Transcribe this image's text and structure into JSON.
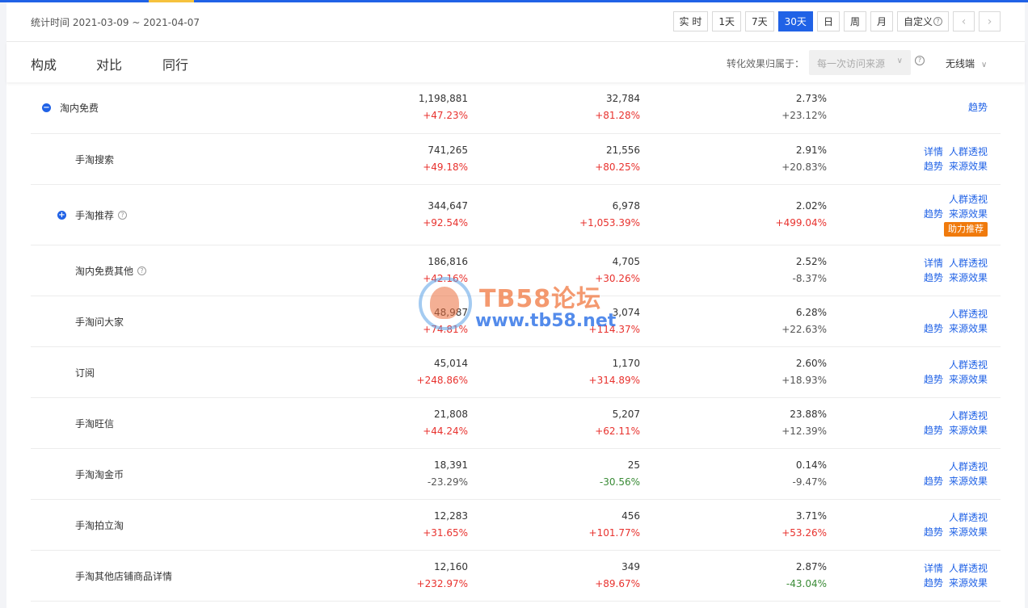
{
  "header": {
    "date_range": "统计时间 2021-03-09 ~ 2021-04-07",
    "periods": [
      {
        "label": "实 时",
        "active": false
      },
      {
        "label": "1天",
        "active": false
      },
      {
        "label": "7天",
        "active": false
      },
      {
        "label": "30天",
        "active": true
      },
      {
        "label": "日",
        "active": false
      },
      {
        "label": "周",
        "active": false
      },
      {
        "label": "月",
        "active": false
      }
    ],
    "custom_label": "自定义",
    "prev_icon": "chevron-left-icon",
    "next_icon": "chevron-right-icon"
  },
  "tabs": [
    {
      "label": "构成",
      "active": true
    },
    {
      "label": "对比",
      "active": false
    },
    {
      "label": "同行",
      "active": false
    }
  ],
  "attribution": {
    "label": "转化效果归属于：",
    "select_value": "每一次访问来源",
    "device": "无线端"
  },
  "colors": {
    "accent": "#2062e6",
    "up": "#e8322e",
    "down": "#3a8b36",
    "boost": "#f07a0c"
  },
  "rows": [
    {
      "name": "淘内免费",
      "level": 0,
      "toggle": "−",
      "help": false,
      "m1": {
        "v": "1,198,881",
        "c": "+47.23%",
        "dir": "up"
      },
      "m2": {
        "v": "32,784",
        "c": "+81.28%",
        "dir": "up"
      },
      "m3": {
        "v": "2.73%",
        "c": "+23.12%",
        "dir": "neutral"
      },
      "actions": [
        [
          "趋势"
        ]
      ],
      "boost": null
    },
    {
      "name": "手淘搜索",
      "level": 1,
      "toggle": null,
      "help": false,
      "m1": {
        "v": "741,265",
        "c": "+49.18%",
        "dir": "up"
      },
      "m2": {
        "v": "21,556",
        "c": "+80.25%",
        "dir": "up"
      },
      "m3": {
        "v": "2.91%",
        "c": "+20.83%",
        "dir": "neutral"
      },
      "actions": [
        [
          "详情",
          "人群透视"
        ],
        [
          "趋势",
          "来源效果"
        ]
      ],
      "boost": null
    },
    {
      "name": "手淘推荐",
      "level": 1,
      "toggle": "+",
      "help": true,
      "m1": {
        "v": "344,647",
        "c": "+92.54%",
        "dir": "up"
      },
      "m2": {
        "v": "6,978",
        "c": "+1,053.39%",
        "dir": "up"
      },
      "m3": {
        "v": "2.02%",
        "c": "+499.04%",
        "dir": "up"
      },
      "actions": [
        [
          "人群透视"
        ],
        [
          "趋势",
          "来源效果"
        ]
      ],
      "boost": "助力推荐"
    },
    {
      "name": "淘内免费其他",
      "level": 1,
      "toggle": null,
      "help": true,
      "m1": {
        "v": "186,816",
        "c": "+42.16%",
        "dir": "up"
      },
      "m2": {
        "v": "4,705",
        "c": "+30.26%",
        "dir": "up"
      },
      "m3": {
        "v": "2.52%",
        "c": "-8.37%",
        "dir": "neutral"
      },
      "actions": [
        [
          "详情",
          "人群透视"
        ],
        [
          "趋势",
          "来源效果"
        ]
      ],
      "boost": null
    },
    {
      "name": "手淘问大家",
      "level": 1,
      "toggle": null,
      "help": false,
      "m1": {
        "v": "48,987",
        "c": "+74.81%",
        "dir": "up"
      },
      "m2": {
        "v": "3,074",
        "c": "+114.37%",
        "dir": "up"
      },
      "m3": {
        "v": "6.28%",
        "c": "+22.63%",
        "dir": "neutral"
      },
      "actions": [
        [
          "人群透视"
        ],
        [
          "趋势",
          "来源效果"
        ]
      ],
      "boost": null
    },
    {
      "name": "订阅",
      "level": 1,
      "toggle": null,
      "help": false,
      "m1": {
        "v": "45,014",
        "c": "+248.86%",
        "dir": "up"
      },
      "m2": {
        "v": "1,170",
        "c": "+314.89%",
        "dir": "up"
      },
      "m3": {
        "v": "2.60%",
        "c": "+18.93%",
        "dir": "neutral"
      },
      "actions": [
        [
          "人群透视"
        ],
        [
          "趋势",
          "来源效果"
        ]
      ],
      "boost": null
    },
    {
      "name": "手淘旺信",
      "level": 1,
      "toggle": null,
      "help": false,
      "m1": {
        "v": "21,808",
        "c": "+44.24%",
        "dir": "up"
      },
      "m2": {
        "v": "5,207",
        "c": "+62.11%",
        "dir": "up"
      },
      "m3": {
        "v": "23.88%",
        "c": "+12.39%",
        "dir": "neutral"
      },
      "actions": [
        [
          "人群透视"
        ],
        [
          "趋势",
          "来源效果"
        ]
      ],
      "boost": null
    },
    {
      "name": "手淘淘金币",
      "level": 1,
      "toggle": null,
      "help": false,
      "m1": {
        "v": "18,391",
        "c": "-23.29%",
        "dir": "neutral"
      },
      "m2": {
        "v": "25",
        "c": "-30.56%",
        "dir": "down"
      },
      "m3": {
        "v": "0.14%",
        "c": "-9.47%",
        "dir": "neutral"
      },
      "actions": [
        [
          "人群透视"
        ],
        [
          "趋势",
          "来源效果"
        ]
      ],
      "boost": null
    },
    {
      "name": "手淘拍立淘",
      "level": 1,
      "toggle": null,
      "help": false,
      "m1": {
        "v": "12,283",
        "c": "+31.65%",
        "dir": "up"
      },
      "m2": {
        "v": "456",
        "c": "+101.77%",
        "dir": "up"
      },
      "m3": {
        "v": "3.71%",
        "c": "+53.26%",
        "dir": "up"
      },
      "actions": [
        [
          "人群透视"
        ],
        [
          "趋势",
          "来源效果"
        ]
      ],
      "boost": null
    },
    {
      "name": "手淘其他店铺商品详情",
      "level": 1,
      "toggle": null,
      "help": false,
      "m1": {
        "v": "12,160",
        "c": "+232.97%",
        "dir": "up"
      },
      "m2": {
        "v": "349",
        "c": "+89.67%",
        "dir": "up"
      },
      "m3": {
        "v": "2.87%",
        "c": "-43.04%",
        "dir": "down"
      },
      "actions": [
        [
          "详情",
          "人群透视"
        ],
        [
          "趋势",
          "来源效果"
        ]
      ],
      "boost": null
    }
  ],
  "watermark": {
    "title": "TB58论坛",
    "url": "www.tb58.net"
  }
}
